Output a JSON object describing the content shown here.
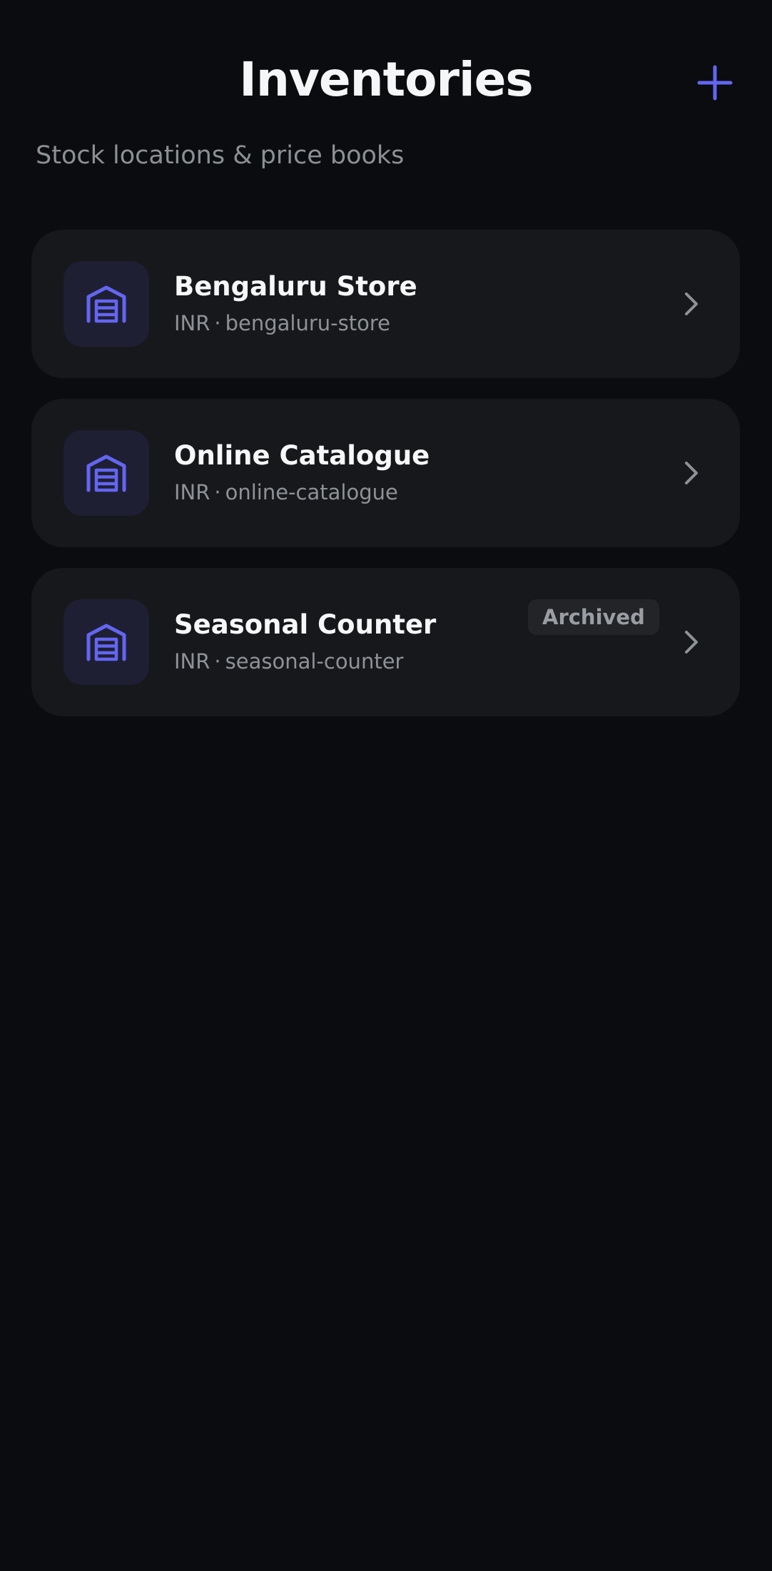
{
  "header": {
    "title": "Inventories",
    "add_icon": "plus-icon",
    "subtitle": "Stock locations & price books"
  },
  "colors": {
    "background": "#0b0c0f",
    "card": "#17181c",
    "accent": "#6366f1",
    "icon_tile": "#1f1f33",
    "muted_text": "#8e9297"
  },
  "inventories": [
    {
      "name": "Bengaluru Store",
      "currency": "INR",
      "separator": "·",
      "slug": "bengaluru-store",
      "icon": "warehouse-icon",
      "badge": ""
    },
    {
      "name": "Online Catalogue",
      "currency": "INR",
      "separator": "·",
      "slug": "online-catalogue",
      "icon": "warehouse-icon",
      "badge": ""
    },
    {
      "name": "Seasonal Counter",
      "currency": "INR",
      "separator": "·",
      "slug": "seasonal-counter",
      "icon": "warehouse-icon",
      "badge": "Archived"
    }
  ]
}
